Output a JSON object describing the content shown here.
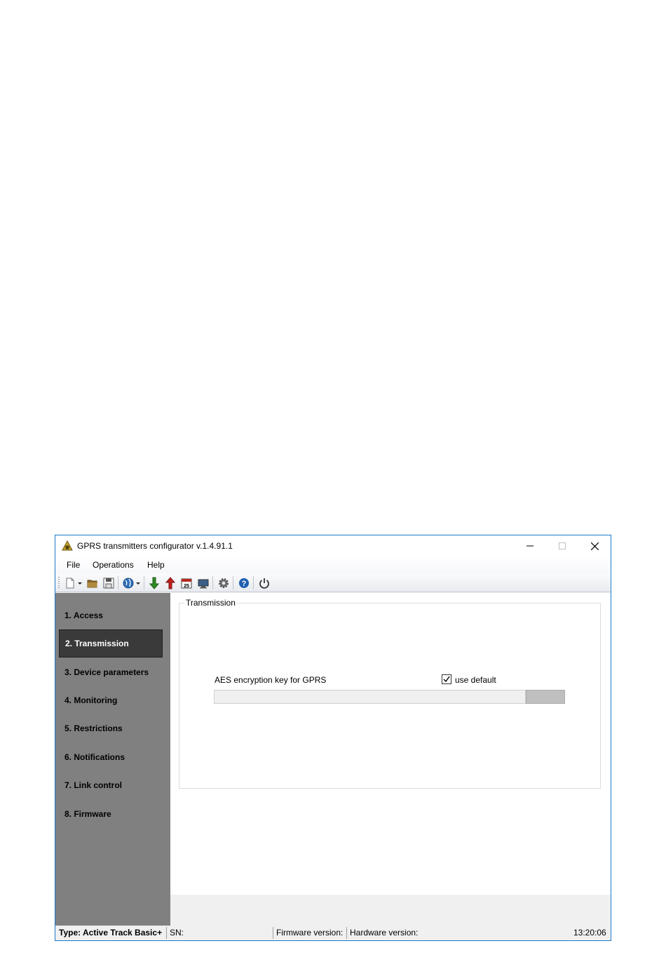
{
  "window": {
    "title": "GPRS transmitters configurator v.1.4.91.1",
    "accent_color": "#1979ca"
  },
  "menu": {
    "items": [
      "File",
      "Operations",
      "Help"
    ]
  },
  "toolbar": {
    "icons": [
      "new-file-icon",
      "dropdown-arrow-icon",
      "open-folder-icon",
      "save-icon",
      "globe-icon",
      "globe-dropdown-icon",
      "download-arrow-icon",
      "upload-arrow-icon",
      "calendar-icon",
      "monitor-icon",
      "gear-icon",
      "help-icon",
      "power-icon"
    ],
    "calendar_day": "25"
  },
  "sidebar": {
    "items": [
      {
        "label": "1. Access"
      },
      {
        "label": "2. Transmission",
        "active": true
      },
      {
        "label": "3. Device parameters"
      },
      {
        "label": "4. Monitoring"
      },
      {
        "label": "5. Restrictions"
      },
      {
        "label": "6. Notifications"
      },
      {
        "label": "7. Link control"
      },
      {
        "label": "8. Firmware"
      }
    ],
    "background": "#808080",
    "active_background": "#3a3a3a"
  },
  "transmission": {
    "group_title": "Transmission",
    "aes_label": "AES encryption key for GPRS",
    "use_default_label": "use default",
    "use_default_checked": true,
    "key_value": ""
  },
  "status": {
    "type": "Type: Active Track Basic+",
    "sn": "SN:",
    "firmware": "Firmware version:",
    "hardware": "Hardware version:",
    "time": "13:20:06"
  }
}
